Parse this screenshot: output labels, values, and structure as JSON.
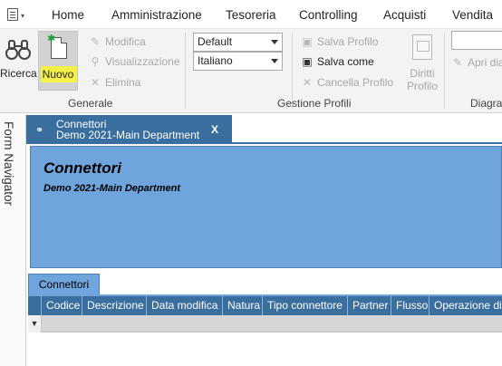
{
  "menubar": {
    "items": [
      "Home",
      "Amministrazione",
      "Tesoreria",
      "Controlling",
      "Acquisti",
      "Vendita"
    ]
  },
  "ribbon": {
    "generale": {
      "ricerca_label": "Ricerca",
      "nuovo_label": "Nuovo",
      "modifica_label": "Modifica",
      "visualizzazione_label": "Visualizzazione",
      "elimina_label": "Elimina",
      "group_label": "Generale"
    },
    "gestione_profili": {
      "layout_value": "Default",
      "language_value": "Italiano",
      "salva_profilo_label": "Salva Profilo",
      "salva_come_label": "Salva come",
      "cancella_profilo_label": "Cancella Profilo",
      "diritti_label_1": "Diritti",
      "diritti_label_2": "Profilo",
      "group_label": "Gestione Profili"
    },
    "diagram": {
      "apri_label": "Apri dia",
      "group_label": "Diagra"
    }
  },
  "sidenav": {
    "label": "Form Navigator"
  },
  "document_tab": {
    "title": "Connettori",
    "subtitle": "Demo 2021-Main Department",
    "close_label": "X"
  },
  "header_panel": {
    "title": "Connettori",
    "subtitle": "Demo 2021-Main Department"
  },
  "grid": {
    "tab_label": "Connettori",
    "columns": [
      "Codice",
      "Descrizione",
      "Data modifica",
      "Natura",
      "Tipo connettore",
      "Partner",
      "Flusso",
      "Operazione di"
    ],
    "filter_icon": "filter-icon"
  },
  "colors": {
    "tab_dark_blue": "#3a6e9e",
    "panel_blue": "#6fa4dd",
    "highlight_yellow": "#f5f047",
    "ribbon_bg": "#f3f3f3"
  }
}
